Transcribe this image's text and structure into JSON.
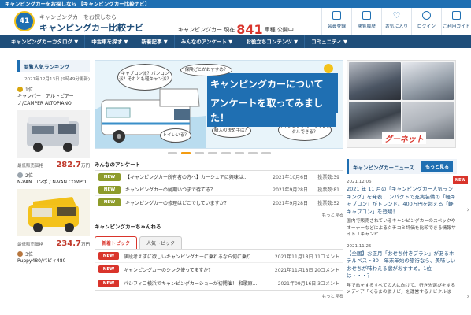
{
  "topbar": {
    "text": "キャンピングカーをお探しなら 【キャンピングカー比較ナビ】"
  },
  "header": {
    "tagline": "キャンピングカーをお探しなら",
    "sitename": "キャンピングカー比較ナビ",
    "count_prefix": "キャンピングカー 現在",
    "count_value": "841",
    "count_suffix": "車種 公開中！",
    "logo_text": "41",
    "buttons": [
      {
        "label": "会員登録",
        "icon": "edit-icon"
      },
      {
        "label": "閲覧履歴",
        "icon": "history-icon"
      },
      {
        "label": "お気に入り",
        "icon": "heart-icon"
      },
      {
        "label": "ログイン",
        "icon": "login-icon"
      },
      {
        "label": "ご利用ガイド",
        "icon": "guide-icon"
      }
    ]
  },
  "nav": [
    "キャンピングカーカタログ ▼",
    "中古車を探す ▼",
    "新着記事 ▼",
    "みんなのアンケート ▼",
    "お役立ちコンテンツ ▼",
    "コミュニティ ▼"
  ],
  "ranking": {
    "title": "閲覧人気ランキング",
    "stamp": "2021年12月13日 (9時49分更新)",
    "items": [
      {
        "rank": "1位",
        "name": "キャンパー　アルトピアーノ/CAMPER ALTOPIANO",
        "price_label": "最低販売価格",
        "price": "282.7",
        "unit": "万円"
      },
      {
        "rank": "2位",
        "name": "N-VAN コンポ / N-VAN COMPO",
        "price_label": "最低販売価格",
        "price": "234.7",
        "unit": "万円"
      },
      {
        "rank": "3位",
        "name": "Puppy480/パピィ480"
      }
    ]
  },
  "banner": {
    "bubbles": [
      "キャブコン派？バンコン派？それとも軽キャン派？",
      "保険どこがおすすめ？",
      "トイレいる？",
      "購入の決め手は？",
      "キャンピングカーってレンタルできる？"
    ],
    "title_line1": "キャンピングカーについて",
    "title_line2": "アンケートを取ってみました！"
  },
  "survey": {
    "title": "みんなのアンケート",
    "rows": [
      {
        "badge": "NEW",
        "text": "【キャンピングカー所有者の方へ】カーシェアに興味は...",
        "date": "2021年10月6日",
        "votes": "投票数:39"
      },
      {
        "badge": "NEW",
        "text": "キャンピングカーの納期いつまで待てる？",
        "date": "2021年9月28日",
        "votes": "投票数:81"
      },
      {
        "badge": "NEW",
        "text": "キャンピングカーの修理はどこでしていますか？",
        "date": "2021年9月28日",
        "votes": "投票数:52"
      }
    ],
    "more": "もっと見る"
  },
  "channel": {
    "title": "キャンピングカーちゃんねる",
    "tabs": [
      "新着トピック",
      "人気トピック"
    ],
    "rows": [
      {
        "badge": "NEW",
        "text": "値段考えずに欲しいキャンピングカーに乗れるなら何に乗り...",
        "date": "2021年11月18日 11コメント"
      },
      {
        "badge": "NEW",
        "text": "キャンピングカーのシンク使ってますか？",
        "date": "2021年11月18日 20コメント"
      },
      {
        "badge": "NEW",
        "text": "パシフィコ横浜でキャンピングカーショーが初開催！ 和歌原...",
        "date": "2021年09月16日 3コメント"
      }
    ],
    "more": "もっと見る"
  },
  "ad": {
    "brand": "グーネット"
  },
  "news": {
    "title": "キャンピングカーニュース",
    "more": "もっと見る",
    "newtag": "NEW",
    "items": [
      {
        "date": "2021.12.06",
        "title": "2021 年 11 月の「キャンピングカー人気ランキング」を発表 コンパクトで充実装備の「軽キャブコン」がトレンド。400万円を超える「軽キャブコン」を登場！",
        "desc": "国内で販売されているキャンピングカーのスペックやオーナーなどによるクチコミ評価を比較できる情報サイト「キャンピ"
      },
      {
        "date": "2021.11.25",
        "title": "【全国】お正月「おせち付きプラン」があるホテルベスト30！年末年始の旅行なら、美味しいおせちが味わえる宿がおすすめ。1位は・・・？",
        "desc": "年で旅をするすべての人に向けて、行き先選びをするメディア「くるまの旅ナビ」を運営するナビクルは"
      }
    ]
  }
}
